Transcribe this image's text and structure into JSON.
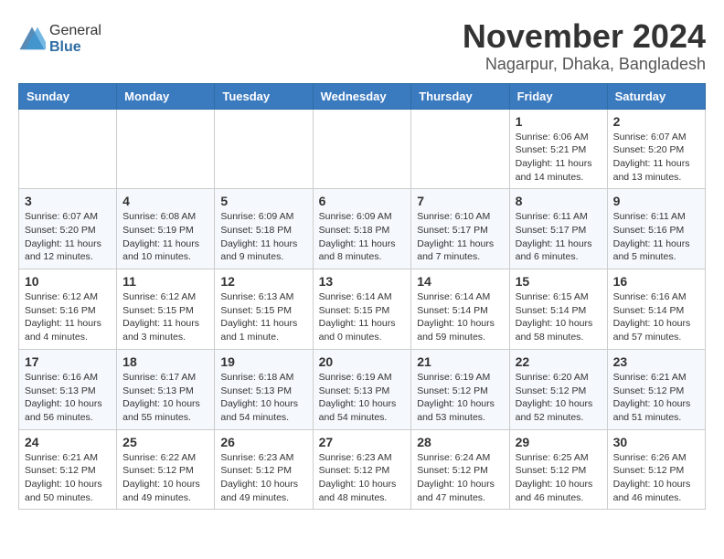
{
  "logo": {
    "general": "General",
    "blue": "Blue"
  },
  "header": {
    "title": "November 2024",
    "subtitle": "Nagarpur, Dhaka, Bangladesh"
  },
  "weekdays": [
    "Sunday",
    "Monday",
    "Tuesday",
    "Wednesday",
    "Thursday",
    "Friday",
    "Saturday"
  ],
  "weeks": [
    [
      {
        "day": "",
        "info": ""
      },
      {
        "day": "",
        "info": ""
      },
      {
        "day": "",
        "info": ""
      },
      {
        "day": "",
        "info": ""
      },
      {
        "day": "",
        "info": ""
      },
      {
        "day": "1",
        "info": "Sunrise: 6:06 AM\nSunset: 5:21 PM\nDaylight: 11 hours and 14 minutes."
      },
      {
        "day": "2",
        "info": "Sunrise: 6:07 AM\nSunset: 5:20 PM\nDaylight: 11 hours and 13 minutes."
      }
    ],
    [
      {
        "day": "3",
        "info": "Sunrise: 6:07 AM\nSunset: 5:20 PM\nDaylight: 11 hours and 12 minutes."
      },
      {
        "day": "4",
        "info": "Sunrise: 6:08 AM\nSunset: 5:19 PM\nDaylight: 11 hours and 10 minutes."
      },
      {
        "day": "5",
        "info": "Sunrise: 6:09 AM\nSunset: 5:18 PM\nDaylight: 11 hours and 9 minutes."
      },
      {
        "day": "6",
        "info": "Sunrise: 6:09 AM\nSunset: 5:18 PM\nDaylight: 11 hours and 8 minutes."
      },
      {
        "day": "7",
        "info": "Sunrise: 6:10 AM\nSunset: 5:17 PM\nDaylight: 11 hours and 7 minutes."
      },
      {
        "day": "8",
        "info": "Sunrise: 6:11 AM\nSunset: 5:17 PM\nDaylight: 11 hours and 6 minutes."
      },
      {
        "day": "9",
        "info": "Sunrise: 6:11 AM\nSunset: 5:16 PM\nDaylight: 11 hours and 5 minutes."
      }
    ],
    [
      {
        "day": "10",
        "info": "Sunrise: 6:12 AM\nSunset: 5:16 PM\nDaylight: 11 hours and 4 minutes."
      },
      {
        "day": "11",
        "info": "Sunrise: 6:12 AM\nSunset: 5:15 PM\nDaylight: 11 hours and 3 minutes."
      },
      {
        "day": "12",
        "info": "Sunrise: 6:13 AM\nSunset: 5:15 PM\nDaylight: 11 hours and 1 minute."
      },
      {
        "day": "13",
        "info": "Sunrise: 6:14 AM\nSunset: 5:15 PM\nDaylight: 11 hours and 0 minutes."
      },
      {
        "day": "14",
        "info": "Sunrise: 6:14 AM\nSunset: 5:14 PM\nDaylight: 10 hours and 59 minutes."
      },
      {
        "day": "15",
        "info": "Sunrise: 6:15 AM\nSunset: 5:14 PM\nDaylight: 10 hours and 58 minutes."
      },
      {
        "day": "16",
        "info": "Sunrise: 6:16 AM\nSunset: 5:14 PM\nDaylight: 10 hours and 57 minutes."
      }
    ],
    [
      {
        "day": "17",
        "info": "Sunrise: 6:16 AM\nSunset: 5:13 PM\nDaylight: 10 hours and 56 minutes."
      },
      {
        "day": "18",
        "info": "Sunrise: 6:17 AM\nSunset: 5:13 PM\nDaylight: 10 hours and 55 minutes."
      },
      {
        "day": "19",
        "info": "Sunrise: 6:18 AM\nSunset: 5:13 PM\nDaylight: 10 hours and 54 minutes."
      },
      {
        "day": "20",
        "info": "Sunrise: 6:19 AM\nSunset: 5:13 PM\nDaylight: 10 hours and 54 minutes."
      },
      {
        "day": "21",
        "info": "Sunrise: 6:19 AM\nSunset: 5:12 PM\nDaylight: 10 hours and 53 minutes."
      },
      {
        "day": "22",
        "info": "Sunrise: 6:20 AM\nSunset: 5:12 PM\nDaylight: 10 hours and 52 minutes."
      },
      {
        "day": "23",
        "info": "Sunrise: 6:21 AM\nSunset: 5:12 PM\nDaylight: 10 hours and 51 minutes."
      }
    ],
    [
      {
        "day": "24",
        "info": "Sunrise: 6:21 AM\nSunset: 5:12 PM\nDaylight: 10 hours and 50 minutes."
      },
      {
        "day": "25",
        "info": "Sunrise: 6:22 AM\nSunset: 5:12 PM\nDaylight: 10 hours and 49 minutes."
      },
      {
        "day": "26",
        "info": "Sunrise: 6:23 AM\nSunset: 5:12 PM\nDaylight: 10 hours and 49 minutes."
      },
      {
        "day": "27",
        "info": "Sunrise: 6:23 AM\nSunset: 5:12 PM\nDaylight: 10 hours and 48 minutes."
      },
      {
        "day": "28",
        "info": "Sunrise: 6:24 AM\nSunset: 5:12 PM\nDaylight: 10 hours and 47 minutes."
      },
      {
        "day": "29",
        "info": "Sunrise: 6:25 AM\nSunset: 5:12 PM\nDaylight: 10 hours and 46 minutes."
      },
      {
        "day": "30",
        "info": "Sunrise: 6:26 AM\nSunset: 5:12 PM\nDaylight: 10 hours and 46 minutes."
      }
    ]
  ]
}
